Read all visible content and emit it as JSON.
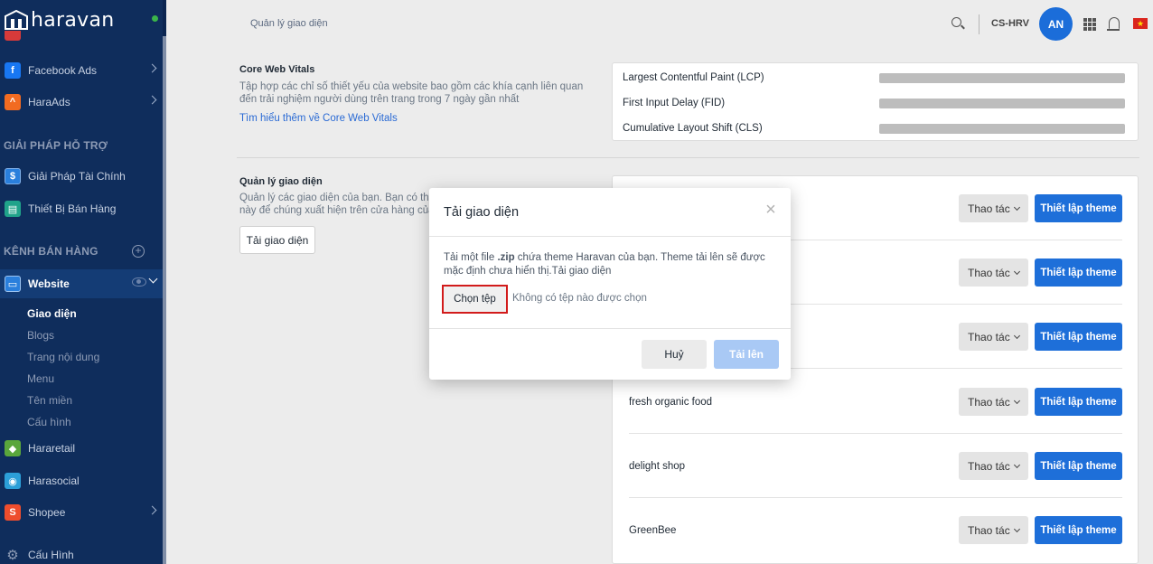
{
  "brand": {
    "name": "haravan"
  },
  "sidebar": {
    "items_top": [
      {
        "label": "Facebook Ads",
        "icon": "facebook-icon",
        "color": "#1877f2"
      },
      {
        "label": "HaraAds",
        "icon": "haraads-icon",
        "color": "#f26b21"
      }
    ],
    "support_section": "GIẢI PHÁP HỖ TRỢ",
    "support_items": [
      {
        "label": "Giải Pháp Tài Chính",
        "icon": "finance-icon",
        "color": "#2a7fdc"
      },
      {
        "label": "Thiết Bị Bán Hàng",
        "icon": "pos-device-icon",
        "color": "#20a38a"
      }
    ],
    "channels_section": "KÊNH BÁN HÀNG",
    "website": {
      "label": "Website",
      "icon": "website-icon"
    },
    "website_sub": [
      "Giao diện",
      "Blogs",
      "Trang nội dung",
      "Menu",
      "Tên miền",
      "Cấu hình"
    ],
    "channels": [
      {
        "label": "Hararetail",
        "icon": "hararetail-icon",
        "color": "#5aa63c"
      },
      {
        "label": "Harasocial",
        "icon": "harasocial-icon",
        "color": "#2c9fd8"
      },
      {
        "label": "Shopee",
        "icon": "shopee-icon",
        "color": "#ee4d2d"
      }
    ],
    "settings_label": "Cấu Hình"
  },
  "header": {
    "breadcrumb": "Quản lý giao diện",
    "store": "CS-HRV",
    "avatar_initials": "AN"
  },
  "cwv": {
    "title": "Core Web Vitals",
    "description": "Tập hợp các chỉ số thiết yếu của website bao gồm các khía cạnh liên quan đến trải nghiệm người dùng trên trang trong 7 ngày gần nhất",
    "link": "Tìm hiểu thêm về Core Web Vitals",
    "metrics": [
      "Largest Contentful Paint (LCP)",
      "First Input Delay (FID)",
      "Cumulative Layout Shift (CLS)"
    ]
  },
  "themes_section": {
    "title": "Quản lý giao diện",
    "description_line1": "Quản lý các giao diện của bạn. Bạn có thể",
    "description_line2": "này để chúng xuất hiện trên cửa hàng của",
    "upload_button": "Tải giao diện",
    "action_label": "Thao tác",
    "setup_label": "Thiết lập theme",
    "themes": [
      "",
      "",
      "",
      "fresh organic food",
      "delight shop",
      "GreenBee"
    ]
  },
  "modal": {
    "title": "Tải giao diện",
    "body_pre": "Tải một file ",
    "body_bold": ".zip",
    "body_post": " chứa theme Haravan của bạn. Theme tải lên sẽ được mặc định chưa hiển thị.Tải giao diện",
    "file_button": "Chọn tệp",
    "file_status": "Không có tệp nào được chọn",
    "cancel": "Huỷ",
    "submit": "Tải lên"
  }
}
